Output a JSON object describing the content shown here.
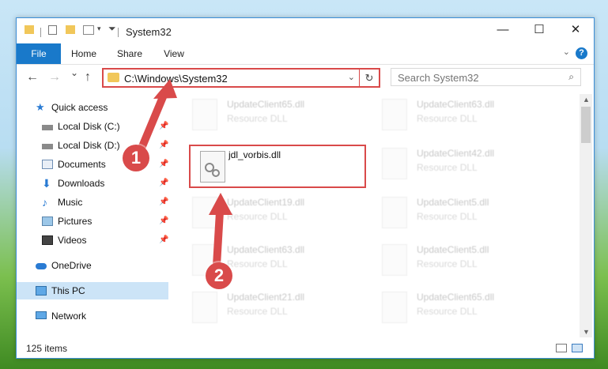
{
  "window": {
    "title": "System32",
    "buttons": {
      "minimize": "—",
      "maximize": "☐",
      "close": "✕"
    }
  },
  "ribbon": {
    "tabs": [
      "File",
      "Home",
      "Share",
      "View"
    ],
    "help": "?"
  },
  "nav": {
    "back": "←",
    "forward": "→",
    "recent": "⌄",
    "up": "↑",
    "address": "C:\\Windows\\System32",
    "refresh": "↻",
    "search_placeholder": "Search System32"
  },
  "sidebar": {
    "items": [
      {
        "label": "Quick access",
        "icon": "star-icon",
        "pinned": false
      },
      {
        "label": "Local Disk (C:)",
        "icon": "drive-icon",
        "pinned": true
      },
      {
        "label": "Local Disk (D:)",
        "icon": "drive-icon",
        "pinned": true
      },
      {
        "label": "Documents",
        "icon": "documents-icon",
        "pinned": true
      },
      {
        "label": "Downloads",
        "icon": "download-icon",
        "pinned": true
      },
      {
        "label": "Music",
        "icon": "music-icon",
        "pinned": true
      },
      {
        "label": "Pictures",
        "icon": "pictures-icon",
        "pinned": true
      },
      {
        "label": "Videos",
        "icon": "videos-icon",
        "pinned": true
      },
      {
        "label": "OneDrive",
        "icon": "cloud-icon",
        "pinned": false
      },
      {
        "label": "This PC",
        "icon": "computer-icon",
        "pinned": false
      },
      {
        "label": "Network",
        "icon": "network-icon",
        "pinned": false
      }
    ]
  },
  "files": {
    "left": [
      {
        "name": "UpdateClient65.dll",
        "type": "Resource DLL"
      },
      {
        "name": "UpdateClient19.dll",
        "type": "Resource DLL"
      },
      {
        "name": "UpdateClient63.dll",
        "type": "Resource DLL"
      },
      {
        "name": "UpdateClient21.dll",
        "type": "Resource DLL"
      }
    ],
    "right": [
      {
        "name": "UpdateClient63.dll",
        "type": "Resource DLL"
      },
      {
        "name": "UpdateClient42.dll",
        "type": "Resource DLL"
      },
      {
        "name": "UpdateClient5.dll",
        "type": "Resource DLL"
      },
      {
        "name": "UpdateClient5.dll",
        "type": "Resource DLL"
      },
      {
        "name": "UpdateClient65.dll",
        "type": "Resource DLL"
      }
    ],
    "highlighted": {
      "name": "jdl_vorbis.dll"
    }
  },
  "status": {
    "item_count": "125 items"
  },
  "annotations": {
    "step1": "1",
    "step2": "2"
  },
  "colors": {
    "accent": "#1979ca",
    "highlight": "#d94a4a"
  }
}
